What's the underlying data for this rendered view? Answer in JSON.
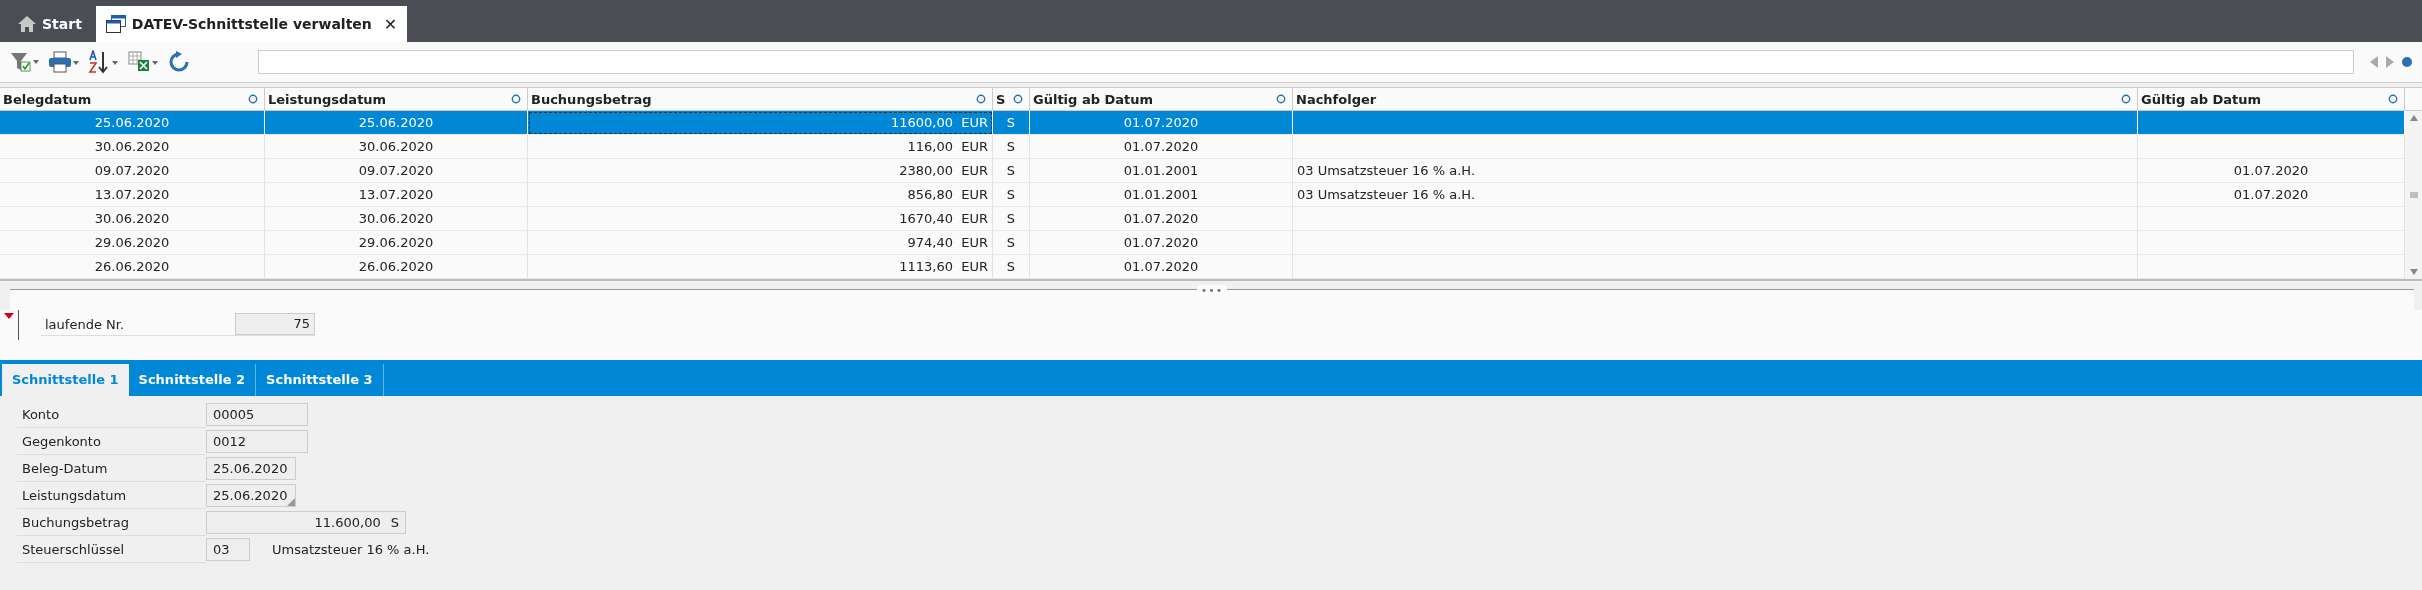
{
  "tabs": [
    {
      "label": "Start",
      "kind": "home",
      "selected": false
    },
    {
      "label": "DATEV-Schnittstelle verwalten",
      "kind": "window",
      "selected": true,
      "close_glyph": "✕"
    }
  ],
  "table": {
    "columns": [
      {
        "label": "Belegdatum"
      },
      {
        "label": "Leistungsdatum"
      },
      {
        "label": "Buchungsbetrag"
      },
      {
        "label": "S"
      },
      {
        "label": "Gültig ab Datum"
      },
      {
        "label": "Nachfolger"
      },
      {
        "label": "Gültig ab Datum"
      }
    ],
    "rows": [
      {
        "selected": true,
        "cells": [
          "25.06.2020",
          "25.06.2020",
          "11600,00  EUR",
          "S",
          "01.07.2020",
          "",
          ""
        ]
      },
      {
        "selected": false,
        "cells": [
          "30.06.2020",
          "30.06.2020",
          "116,00  EUR",
          "S",
          "01.07.2020",
          "",
          ""
        ]
      },
      {
        "selected": false,
        "cells": [
          "09.07.2020",
          "09.07.2020",
          "2380,00  EUR",
          "S",
          "01.01.2001",
          "03 Umsatzsteuer 16 % a.H.",
          "01.07.2020"
        ]
      },
      {
        "selected": false,
        "cells": [
          "13.07.2020",
          "13.07.2020",
          "856,80  EUR",
          "S",
          "01.01.2001",
          "03 Umsatzsteuer 16 % a.H.",
          "01.07.2020"
        ]
      },
      {
        "selected": false,
        "cells": [
          "30.06.2020",
          "30.06.2020",
          "1670,40  EUR",
          "S",
          "01.07.2020",
          "",
          ""
        ]
      },
      {
        "selected": false,
        "cells": [
          "29.06.2020",
          "29.06.2020",
          "974,40  EUR",
          "S",
          "01.07.2020",
          "",
          ""
        ]
      },
      {
        "selected": false,
        "cells": [
          "26.06.2020",
          "26.06.2020",
          "1113,60  EUR",
          "S",
          "01.07.2020",
          "",
          ""
        ]
      }
    ]
  },
  "splitter_glyph": "•••",
  "detail": {
    "label": "laufende Nr.",
    "value": "75"
  },
  "sub_tabs": [
    {
      "label": "Schnittstelle 1",
      "selected": true
    },
    {
      "label": "Schnittstelle 2",
      "selected": false
    },
    {
      "label": "Schnittstelle 3",
      "selected": false
    }
  ],
  "form": [
    {
      "label": "Konto",
      "value": "00005",
      "kind": "text"
    },
    {
      "label": "Gegenkonto",
      "value": "0012",
      "kind": "text"
    },
    {
      "label": "Beleg-Datum",
      "value": "25.06.2020",
      "kind": "date"
    },
    {
      "label": "Leistungsdatum",
      "value": "25.06.2020",
      "kind": "date_corner"
    },
    {
      "label": "Buchungsbetrag",
      "value": "11.600,00",
      "suffix": "S",
      "kind": "amount"
    },
    {
      "label": "Steuerschlüssel",
      "value": "03",
      "note": "Umsatzsteuer 16 % a.H.",
      "kind": "code"
    }
  ]
}
